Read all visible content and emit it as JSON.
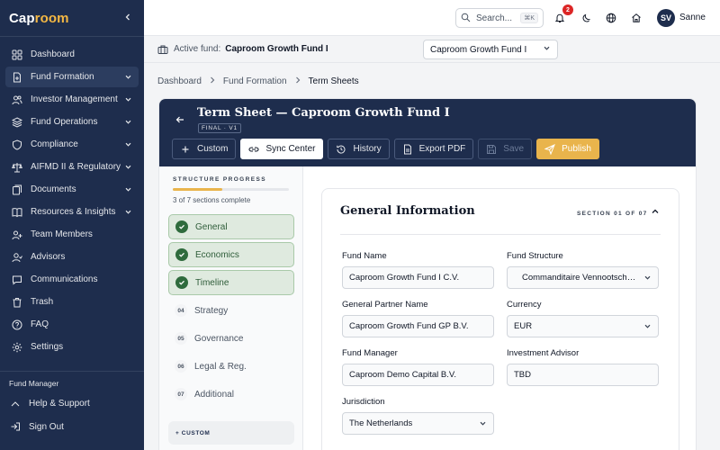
{
  "brand": {
    "name_main": "Cap",
    "name_accent": "room"
  },
  "sidebar": {
    "items": [
      {
        "label": "Dashboard",
        "icon": "dashboard-icon"
      },
      {
        "label": "Fund Formation",
        "icon": "file-plus-icon",
        "active": true,
        "chevron": true
      },
      {
        "label": "Investor Management",
        "icon": "users-icon",
        "chevron": true
      },
      {
        "label": "Fund Operations",
        "icon": "layers-icon",
        "chevron": true
      },
      {
        "label": "Compliance",
        "icon": "shield-icon",
        "chevron": true
      },
      {
        "label": "AIFMD II & Regulatory",
        "icon": "scale-icon",
        "chevron": true
      },
      {
        "label": "Documents",
        "icon": "documents-icon",
        "chevron": true
      },
      {
        "label": "Resources & Insights",
        "icon": "book-icon",
        "chevron": true
      },
      {
        "label": "Team Members",
        "icon": "team-icon"
      },
      {
        "label": "Advisors",
        "icon": "advisor-icon"
      },
      {
        "label": "Communications",
        "icon": "message-icon"
      },
      {
        "label": "Trash",
        "icon": "trash-icon"
      },
      {
        "label": "FAQ",
        "icon": "help-circle-icon"
      },
      {
        "label": "Settings",
        "icon": "gear-icon"
      }
    ],
    "role": "Fund Manager",
    "help_label": "Help & Support",
    "signout_label": "Sign Out"
  },
  "topbar": {
    "search_placeholder": "Search...",
    "search_shortcut": "⌘K",
    "notification_count": "2",
    "avatar_initials": "SV",
    "username": "Sanne"
  },
  "fundbar": {
    "label": "Active fund:",
    "value": "Caproom Growth Fund I",
    "select_value": "Caproom Growth Fund I"
  },
  "breadcrumb": [
    "Dashboard",
    "Fund Formation",
    "Term Sheets"
  ],
  "document": {
    "title": "Term Sheet — Caproom Growth Fund I",
    "status": "FINAL · V1"
  },
  "toolbar": {
    "custom": "Custom",
    "sync": "Sync Center",
    "history": "History",
    "export": "Export PDF",
    "save": "Save",
    "publish": "Publish"
  },
  "progress": {
    "title": "STRUCTURE PROGRESS",
    "fraction": 0.43,
    "count_text": "3 of 7 sections complete",
    "steps": [
      {
        "label": "General",
        "done": true
      },
      {
        "label": "Economics",
        "done": true
      },
      {
        "label": "Timeline",
        "done": true
      },
      {
        "num": "04",
        "label": "Strategy"
      },
      {
        "num": "05",
        "label": "Governance"
      },
      {
        "num": "06",
        "label": "Legal & Reg."
      },
      {
        "num": "07",
        "label": "Additional"
      }
    ],
    "add_custom": "+ CUSTOM"
  },
  "section": {
    "title": "General Information",
    "counter": "SECTION 01 OF 07",
    "fields": {
      "fund_name": {
        "label": "Fund Name",
        "value": "Caproom Growth Fund I C.V."
      },
      "fund_structure": {
        "label": "Fund Structure",
        "value": "Commanditaire Vennootschap..."
      },
      "gp_name": {
        "label": "General Partner Name",
        "value": "Caproom Growth Fund GP B.V."
      },
      "currency": {
        "label": "Currency",
        "value": "EUR"
      },
      "fund_manager": {
        "label": "Fund Manager",
        "value": "Caproom Demo Capital B.V."
      },
      "investment_advisor": {
        "label": "Investment Advisor",
        "value": "TBD"
      },
      "jurisdiction": {
        "label": "Jurisdiction",
        "value": "The Netherlands"
      }
    }
  },
  "colors": {
    "navy": "#1e2d4d",
    "gold": "#e9b44c",
    "green": "#2f6b3d"
  }
}
